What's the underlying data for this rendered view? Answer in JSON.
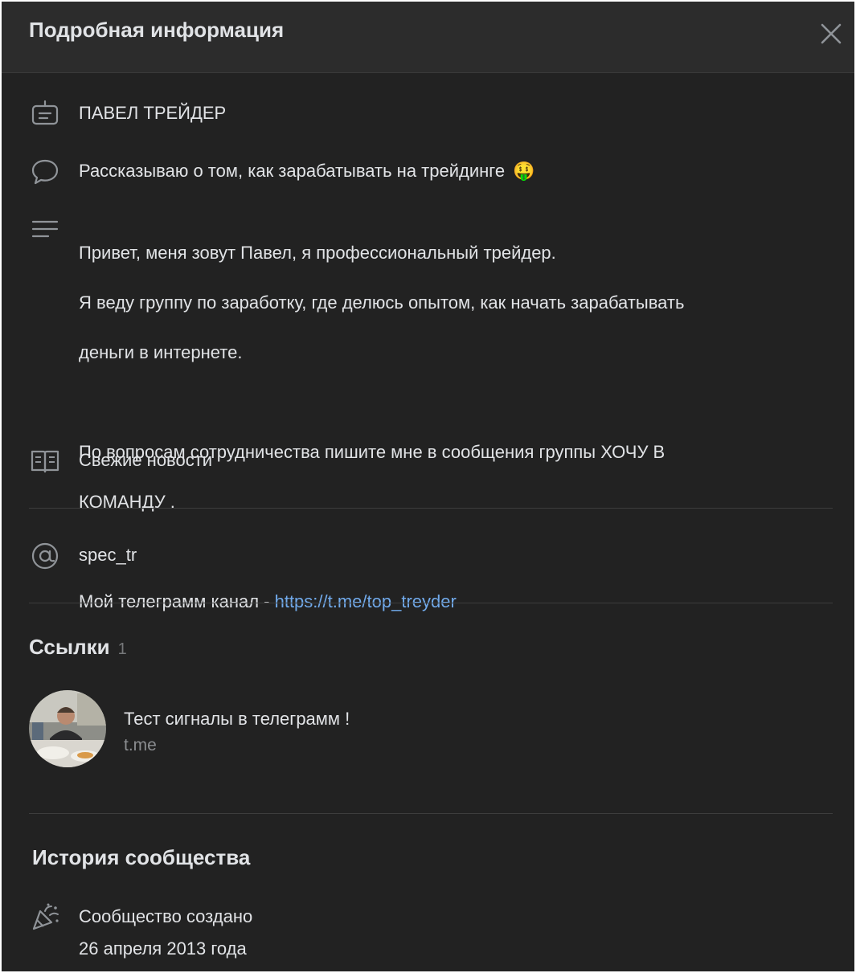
{
  "header": {
    "title": "Подробная информация",
    "close_icon": "close-icon"
  },
  "info": {
    "name": "ПАВЕЛ ТРЕЙДЕР",
    "status": "Рассказываю о том, как зарабатывать на трейдинге",
    "status_emoji": "🤑",
    "description_lines": [
      "Привет, меня зовут Павел, я профессиональный трейдер.",
      "Я веду группу по заработку, где делюсь опытом, как начать зарабатывать",
      "деньги в интернете."
    ],
    "cooperation_lines": [
      "По вопросам сотрудничества пишите мне в сообщения группы ХОЧУ В",
      "КОМАНДУ ."
    ],
    "telegram_prefix": "Мой телеграмм канал - ",
    "telegram_link": "https://t.me/top_treyder",
    "news_link": "Свежие новости",
    "short_name": "spec_tr"
  },
  "links": {
    "title": "Ссылки",
    "count": "1",
    "items": [
      {
        "title": "Тест сигналы в телеграмм !",
        "domain": "t.me"
      }
    ]
  },
  "history": {
    "title": "История сообщества",
    "event": "Сообщество создано",
    "date": "26 апреля 2013 года"
  },
  "colors": {
    "background": "#222222",
    "header": "#2c2c2c",
    "text": "#e1e3e6",
    "link": "#71aaeb",
    "muted": "#8b8d90"
  }
}
